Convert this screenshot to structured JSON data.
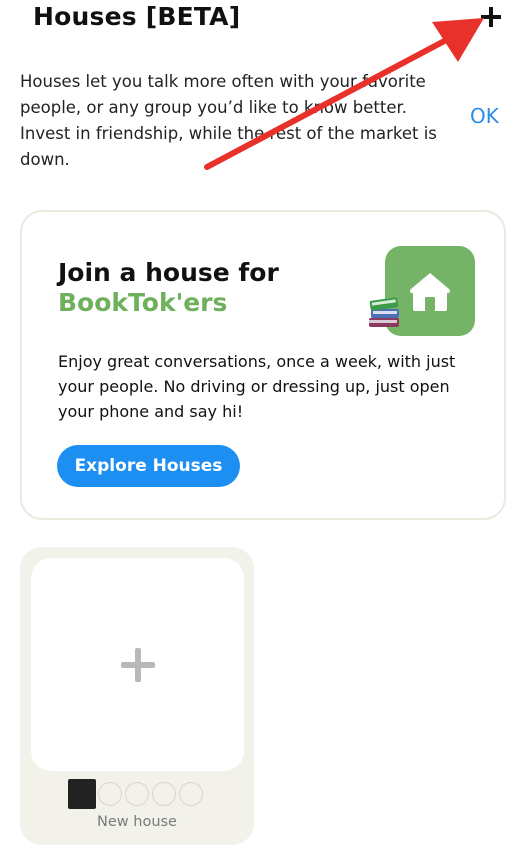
{
  "header": {
    "title": "Houses [BETA]",
    "add_icon": "plus-icon"
  },
  "intro": {
    "text": "Houses let you talk more often with your favorite people, or any group you’d like to know better. Invest in friendship, while the rest of the market is down.",
    "ok_label": "OK"
  },
  "promo_card": {
    "title_line1": "Join a house for",
    "title_line2": "BookTok'ers",
    "body": "Enjoy great conversations, once a week, with just your people. No driving or dressing up, just open your phone and say hi!",
    "button_label": "Explore Houses",
    "icons": [
      "house-icon",
      "books-icon"
    ],
    "accent_color": "#6fb05d"
  },
  "new_house_tile": {
    "label": "New house",
    "icon": "plus-icon"
  },
  "annotation": {
    "arrow_color": "#e8312a"
  },
  "colors": {
    "link": "#2b8de4",
    "button": "#1e8ff2",
    "tile_bg": "#f2f1ea"
  }
}
